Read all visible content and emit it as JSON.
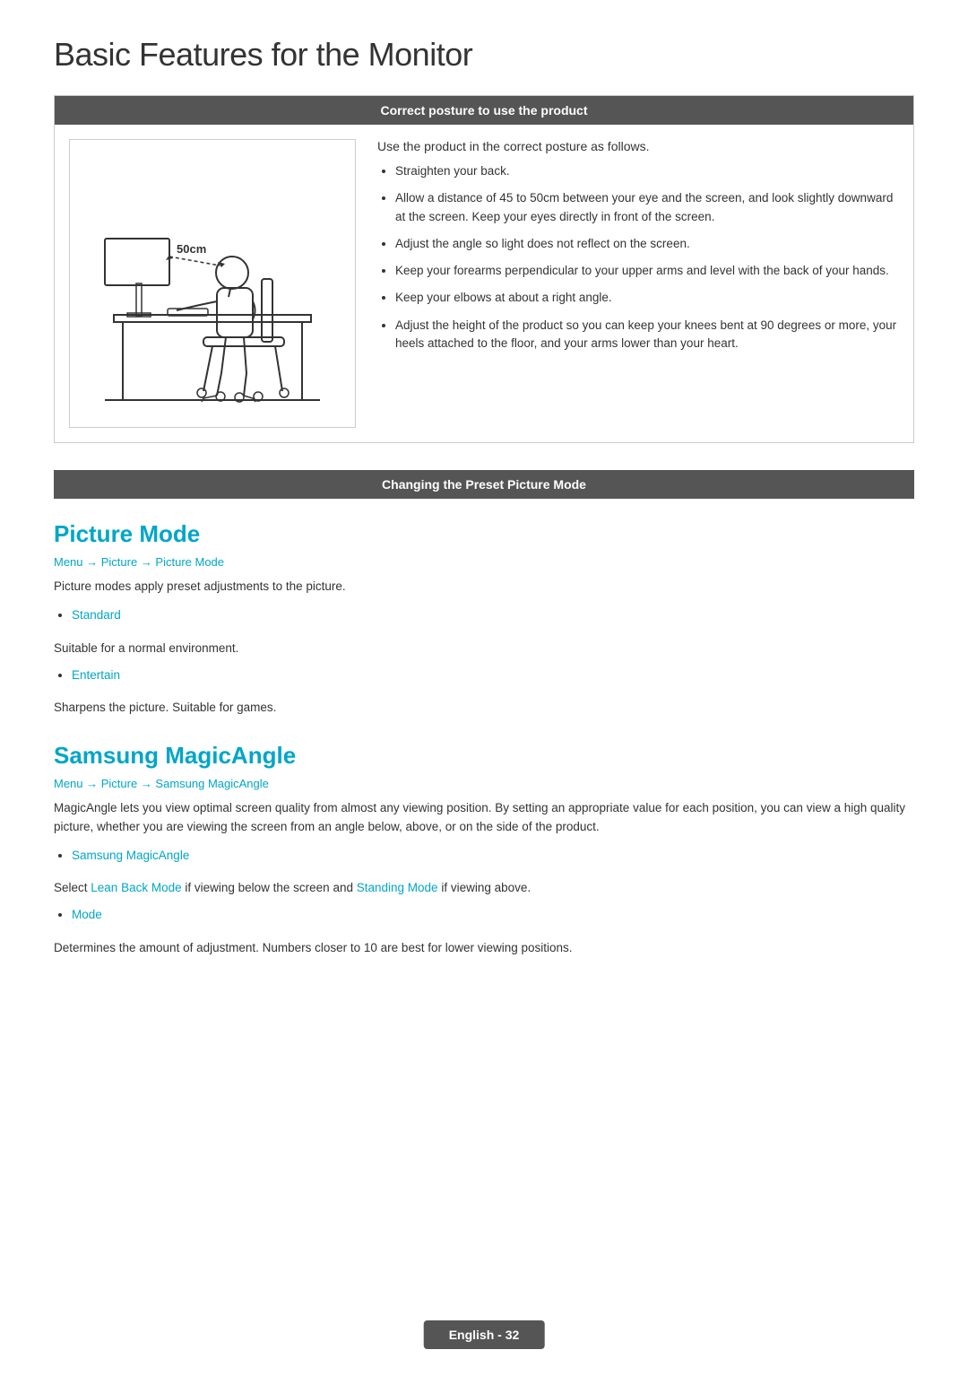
{
  "page": {
    "title": "Basic Features for the Monitor",
    "footer": "English - 32"
  },
  "correct_posture": {
    "header": "Correct posture to use the product",
    "intro": "Use the product in the correct posture as follows.",
    "distance_label": "50cm",
    "bullets": [
      "Straighten your back.",
      "Allow a distance of 45 to 50cm between your eye and the screen, and look slightly downward at the screen. Keep your eyes directly in front of the screen.",
      "Adjust the angle so light does not reflect on the screen.",
      "Keep your forearms perpendicular to your upper arms and level with the back of your hands.",
      "Keep your elbows at about a right angle.",
      "Adjust the height of the product so you can keep your knees bent at 90 degrees or more, your heels attached to the floor, and your arms lower than your heart."
    ]
  },
  "changing_preset": {
    "header": "Changing the Preset Picture Mode"
  },
  "picture_mode": {
    "title": "Picture Mode",
    "breadcrumb": "Menu → Picture → Picture Mode",
    "desc": "Picture modes apply preset adjustments to the picture.",
    "items": [
      {
        "label": "Standard",
        "desc": "Suitable for a normal environment."
      },
      {
        "label": "Entertain",
        "desc": "Sharpens the picture. Suitable for games."
      }
    ]
  },
  "samsung_magicangle": {
    "title": "Samsung MagicAngle",
    "breadcrumb": "Menu → Picture → Samsung MagicAngle",
    "desc": "MagicAngle lets you view optimal screen quality from almost any viewing position. By setting an appropriate value for each position, you can view a high quality picture, whether you are viewing the screen from an angle below, above, or on the side of the product.",
    "items": [
      {
        "label": "Samsung MagicAngle",
        "desc_before": "Select ",
        "lean_back": "Lean Back Mode",
        "desc_mid": " if viewing below the screen and ",
        "standing": "Standing Mode",
        "desc_after": " if viewing above."
      },
      {
        "label": "Mode",
        "desc": "Determines the amount of adjustment. Numbers closer to 10 are best for lower viewing positions."
      }
    ]
  }
}
